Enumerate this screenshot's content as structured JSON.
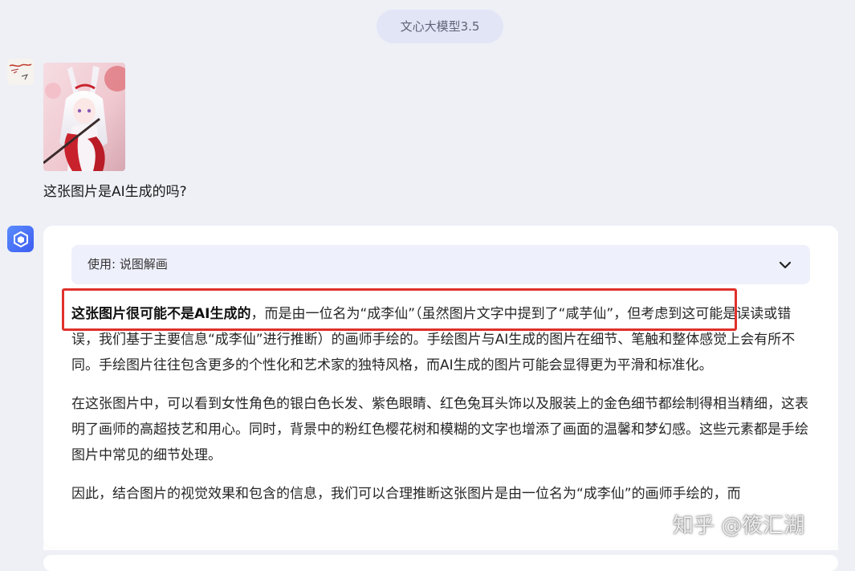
{
  "header": {
    "model_label": "文心大模型3.5"
  },
  "user_message": {
    "text": "这张图片是AI生成的吗?"
  },
  "bot_message": {
    "plugin_label": "使用: 说图解画",
    "paragraphs": [
      {
        "bold": "这张图片很可能不是AI生成的",
        "text": "，而是由一位名为“成李仙”（虽然图片文字中提到了“咸芋仙”，但考虑到这可能是误读或错误，我们基于主要信息“成李仙”进行推断）的画师手绘的。手绘图片与AI生成的图片在细节、笔触和整体感觉上会有所不同。手绘图片往往包含更多的个性化和艺术家的独特风格，而AI生成的图片可能会显得更为平滑和标准化。"
      },
      {
        "bold": "",
        "text": "在这张图片中，可以看到女性角色的银白色长发、紫色眼睛、红色兔耳头饰以及服装上的金色细节都绘制得相当精细，这表明了画师的高超技艺和用心。同时，背景中的粉红色樱花树和模糊的文字也增添了画面的温馨和梦幻感。这些元素都是手绘图片中常见的细节处理。"
      },
      {
        "bold": "",
        "text": "因此，结合图片的视觉效果和包含的信息，我们可以合理推断这张图片是由一位名为“成李仙”的画师手绘的，而"
      }
    ]
  },
  "watermark": "知乎 @筱汇湖",
  "colors": {
    "highlight": "#e0302c",
    "card_bg": "#ffffff",
    "page_bg": "#eef0f6",
    "plugin_bg": "#eef0fb"
  }
}
